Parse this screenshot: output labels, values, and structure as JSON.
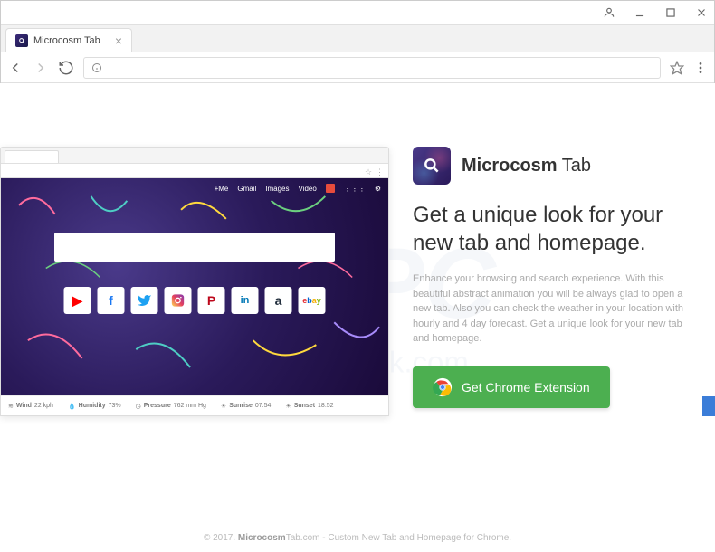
{
  "window": {
    "tab_title": "Microcosm Tab"
  },
  "preview": {
    "nav": [
      "+Me",
      "Gmail",
      "Images",
      "Video"
    ],
    "icons": [
      {
        "name": "youtube",
        "glyph": "▶",
        "color": "#ff0000"
      },
      {
        "name": "facebook",
        "glyph": "f",
        "color": "#1877f2"
      },
      {
        "name": "twitter",
        "glyph": "🐦",
        "color": "#1da1f2"
      },
      {
        "name": "instagram",
        "glyph": "◉",
        "color": "#e4405f"
      },
      {
        "name": "pinterest",
        "glyph": "P",
        "color": "#bd081c"
      },
      {
        "name": "linkedin",
        "glyph": "in",
        "color": "#0077b5"
      },
      {
        "name": "amazon",
        "glyph": "a",
        "color": "#232f3e"
      },
      {
        "name": "ebay",
        "glyph": "eb",
        "color": "#e53238"
      }
    ],
    "stats": {
      "wind_label": "Wind",
      "wind_value": "22 kph",
      "humidity_label": "Humidity",
      "humidity_value": "73%",
      "pressure_label": "Pressure",
      "pressure_value": "762 mm Hg",
      "sunrise_label": "Sunrise",
      "sunrise_value": "07:54",
      "sunset_label": "Sunset",
      "sunset_value": "18:52"
    }
  },
  "brand": {
    "name_bold": "Microcosm",
    "name_light": " Tab"
  },
  "headline": "Get a unique look for your new tab and homepage.",
  "description": "Enhance your browsing and search experience. With this beautiful abstract animation you will be always glad to open a new tab. Also you can check the weather in your location with hourly and 4 day forecast. Get a unique look for your new tab and homepage.",
  "cta_label": "Get Chrome Extension",
  "footer": {
    "copyright": "© 2017.",
    "site_bold": "Microcosm",
    "site_rest": "Tab.com",
    "tagline": " - Custom New Tab and Homepage for Chrome."
  }
}
